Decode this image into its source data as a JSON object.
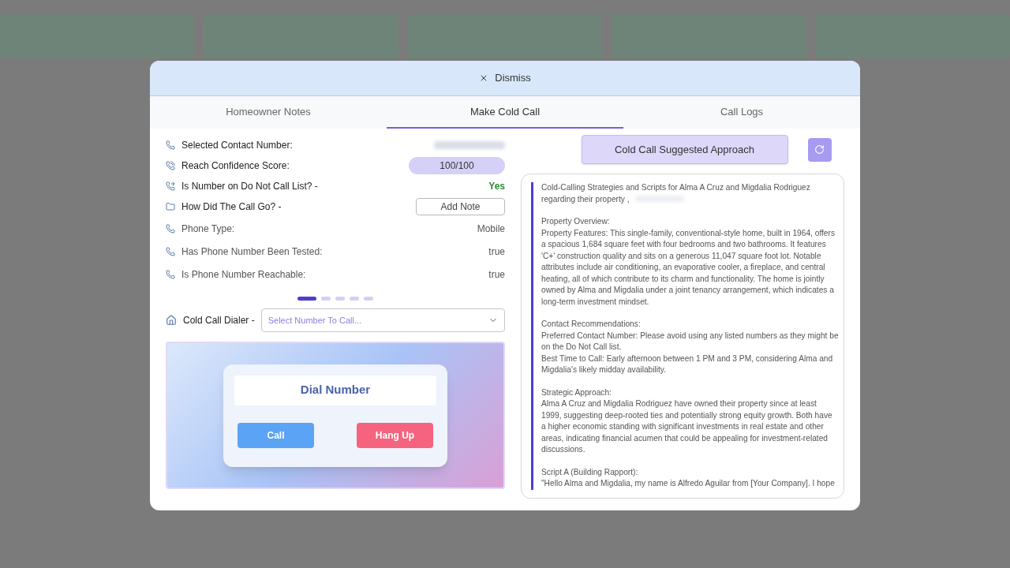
{
  "dialog": {
    "dismiss": "Dismiss"
  },
  "tabs": [
    {
      "label": "Homeowner Notes",
      "selected": false
    },
    {
      "label": "Make Cold Call",
      "selected": true
    },
    {
      "label": "Call Logs",
      "selected": false
    }
  ],
  "details": [
    {
      "kind": "blurred",
      "label": "Selected Contact Number:"
    },
    {
      "kind": "pill",
      "label": "Reach Confidence Score:",
      "value": "100/100"
    },
    {
      "kind": "status",
      "label": "Is Number on Do Not Call List? -",
      "value": "Yes"
    },
    {
      "kind": "button",
      "label": "How Did The Call Go? -",
      "value": "Add Note"
    },
    {
      "kind": "text",
      "label": "Phone Type:",
      "value": "Mobile"
    },
    {
      "kind": "text",
      "label": "Has Phone Number Been Tested:",
      "value": "true"
    },
    {
      "kind": "text",
      "label": "Is Phone Number Reachable:",
      "value": "true"
    }
  ],
  "pager": [
    {
      "selected": true
    },
    {
      "selected": false
    },
    {
      "selected": false
    },
    {
      "selected": false
    },
    {
      "selected": false
    }
  ],
  "dialer": {
    "label": "Cold Call Dialer -",
    "placeholder": "Select Number To Call...",
    "display": "Dial Number",
    "call": "Call",
    "hang_up": "Hang Up"
  },
  "approach": {
    "button": "Cold Call Suggested Approach",
    "sections": [
      [
        "Cold-Calling Strategies and Scripts for Alma A Cruz and Migdalia Rodriguez regarding their property ,"
      ],
      [
        "Property Overview:",
        "Property Features: This single-family, conventional-style home, built in 1964, offers a spacious 1,684 square feet with four bedrooms and two bathrooms. It features 'C+' construction quality and sits on a generous 11,047 square foot lot. Notable attributes include air conditioning, an evaporative cooler, a fireplace, and central heating, all of which contribute to its charm and functionality. The home is jointly owned by Alma and Migdalia under a joint tenancy arrangement, which indicates a long-term investment mindset."
      ],
      [
        "Contact Recommendations:",
        "Preferred Contact Number: Please avoid using any listed numbers as they might be on the Do Not Call list.",
        "Best Time to Call: Early afternoon between 1 PM and 3 PM, considering Alma and Migdalia's likely midday availability."
      ],
      [
        "Strategic Approach:",
        "Alma A Cruz and Migdalia Rodriguez have owned their property since at least 1999, suggesting deep-rooted ties and potentially strong equity growth. Both have a higher economic standing with significant investments in real estate and other areas, indicating financial acumen that could be appealing for investment-related discussions."
      ],
      [
        "Script A (Building Rapport):",
        "\"Hello Alma and Migdalia, my name is Alfredo Aguilar from [Your Company]. I hope"
      ]
    ]
  }
}
